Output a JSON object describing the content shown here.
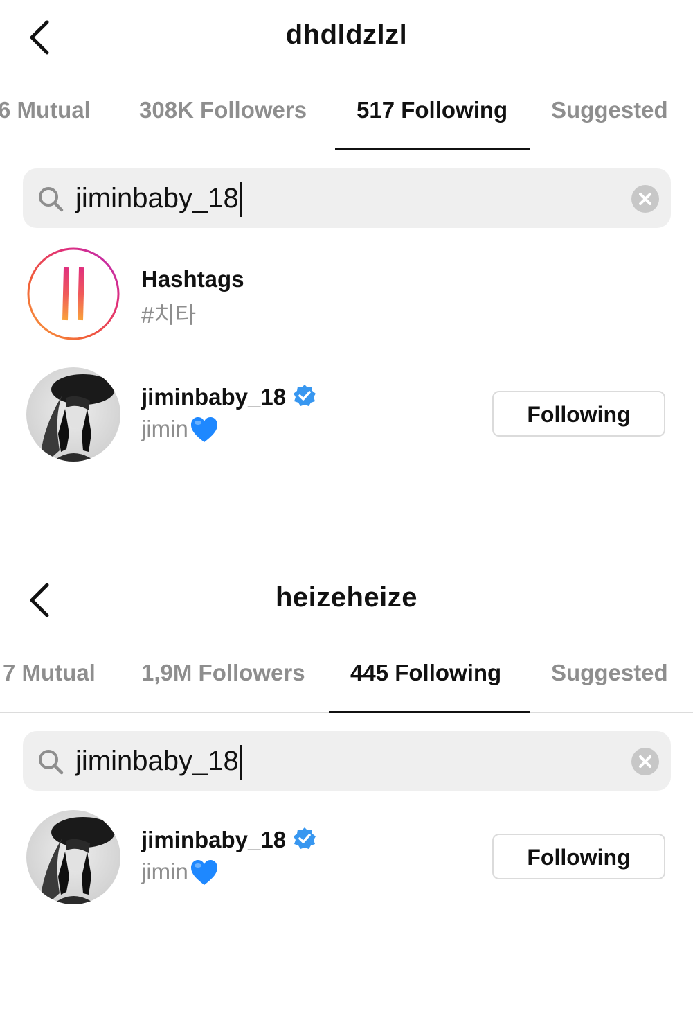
{
  "colors": {
    "verified_blue": "#3897f0",
    "heart_blue": "#1e88ff",
    "inactive_text": "#8e8e8e"
  },
  "screens": [
    {
      "title": "dhdldzlzl",
      "back_icon": "chevron-left-icon",
      "tabs": [
        "6 Mutual",
        "308K Followers",
        "517 Following",
        "Suggested"
      ],
      "active_tab": "517 Following",
      "search": {
        "value": "jiminbaby_18",
        "icon": "search-icon",
        "clear_icon": "clear-circle-icon"
      },
      "hashtag_result": {
        "title": "Hashtags",
        "subtitle": "#치타",
        "icon": "hashtag-icon"
      },
      "user_result": {
        "username": "jiminbaby_18",
        "name": "jimin",
        "verified": true,
        "emoji": "blue-heart",
        "button": "Following"
      }
    },
    {
      "title": "heizeheize",
      "back_icon": "chevron-left-icon",
      "tabs": [
        "7 Mutual",
        "1,9M Followers",
        "445 Following",
        "Suggested"
      ],
      "active_tab": "445 Following",
      "search": {
        "value": "jiminbaby_18",
        "icon": "search-icon",
        "clear_icon": "clear-circle-icon"
      },
      "user_result": {
        "username": "jiminbaby_18",
        "name": "jimin",
        "verified": true,
        "emoji": "blue-heart",
        "button": "Following"
      }
    }
  ]
}
